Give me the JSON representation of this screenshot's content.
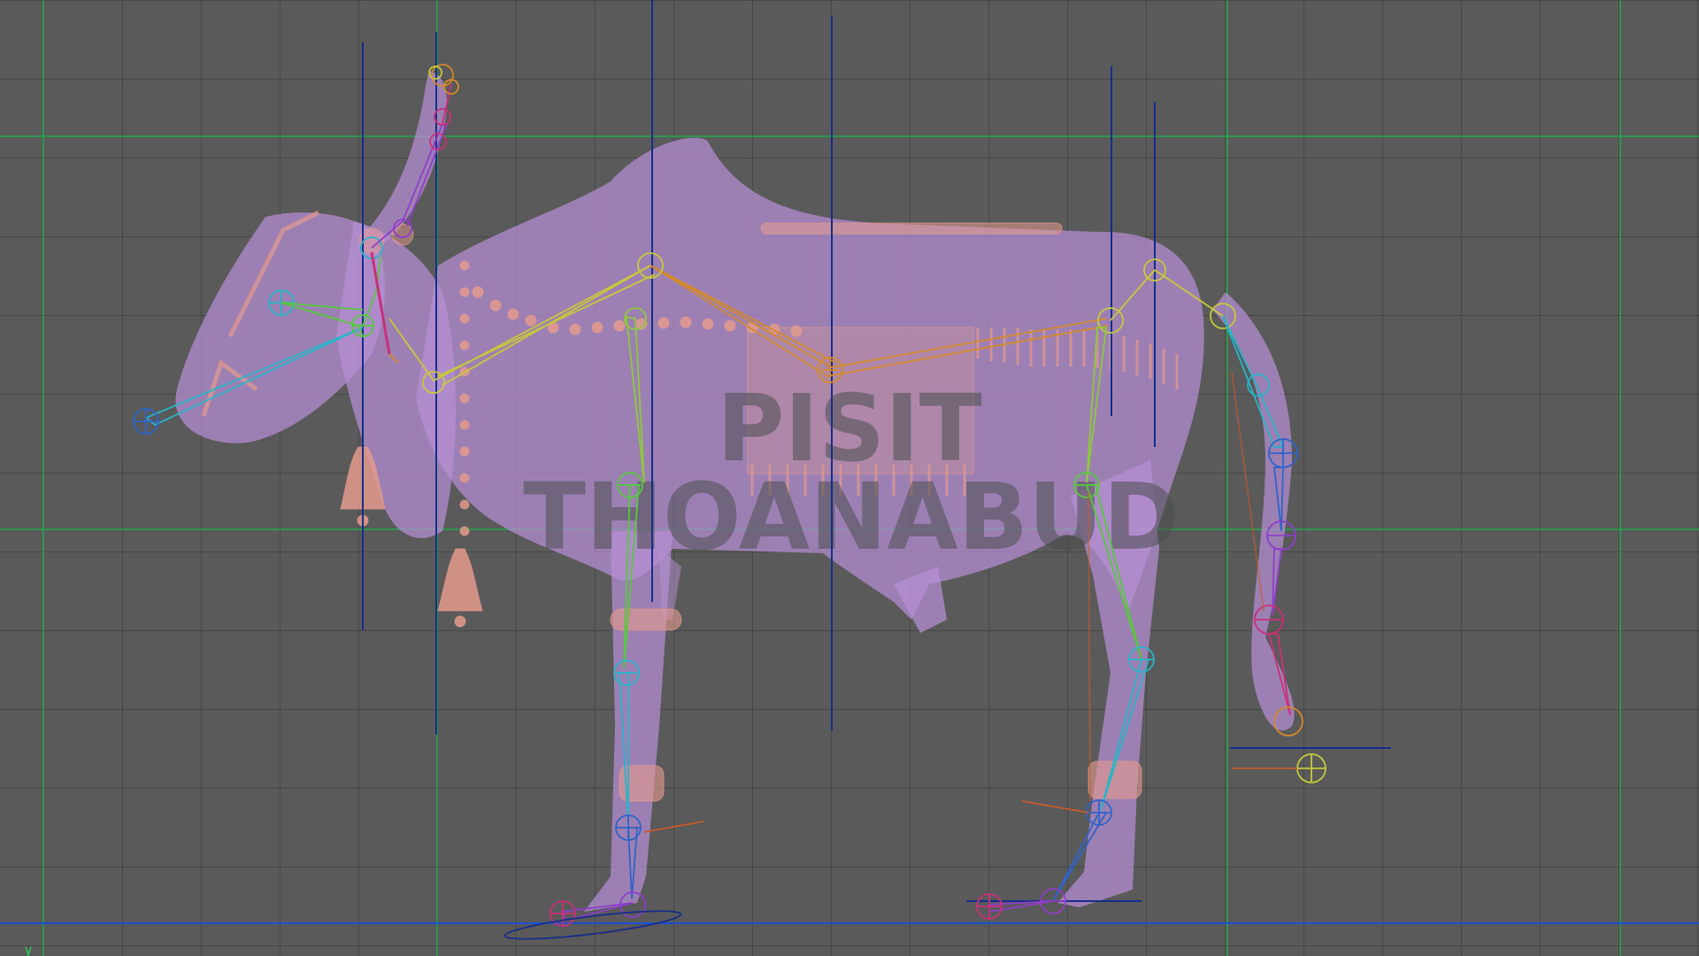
{
  "viewport": {
    "background": "#5a5a5a",
    "grid_color": "#3c3c3c",
    "axis_green": "#19b34a",
    "ground_line_color": "#1a4fd6"
  },
  "model": {
    "body_color": "#b78fd6",
    "ornament_color": "#e49a8d"
  },
  "watermark": {
    "line1": "PISIT",
    "line2": "THOANABUD"
  },
  "axis_indicator": {
    "label": "y"
  },
  "rig": {
    "colors": {
      "blue": "#2f64c9",
      "cyan": "#26b5c9",
      "green": "#56c93c",
      "yellow": "#c6c93a",
      "orange": "#d48a2a",
      "purple": "#8e3ec9",
      "magenta": "#c9307a",
      "navy": "#152d8c"
    }
  }
}
